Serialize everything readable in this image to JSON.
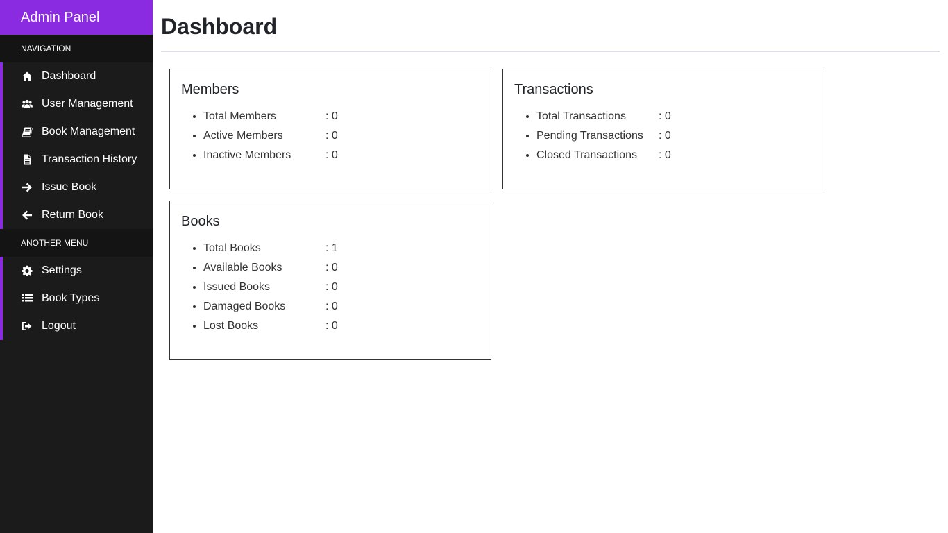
{
  "sidebar": {
    "brand": "Admin Panel",
    "sections": [
      {
        "header": "NAVIGATION",
        "items": [
          {
            "label": "Dashboard",
            "icon": "home-icon"
          },
          {
            "label": "User Management",
            "icon": "users-icon"
          },
          {
            "label": "Book Management",
            "icon": "book-icon"
          },
          {
            "label": "Transaction History",
            "icon": "file-icon"
          },
          {
            "label": "Issue Book",
            "icon": "arrow-right-icon"
          },
          {
            "label": "Return Book",
            "icon": "arrow-left-icon"
          }
        ]
      },
      {
        "header": "ANOTHER MENU",
        "items": [
          {
            "label": "Settings",
            "icon": "gear-icon"
          },
          {
            "label": "Book Types",
            "icon": "list-icon"
          },
          {
            "label": "Logout",
            "icon": "logout-icon"
          }
        ]
      }
    ]
  },
  "main": {
    "title": "Dashboard",
    "cards": {
      "members": {
        "title": "Members",
        "rows": [
          {
            "label": "Total Members",
            "value": ": 0"
          },
          {
            "label": "Active Members",
            "value": ": 0"
          },
          {
            "label": "Inactive Members",
            "value": ": 0"
          }
        ]
      },
      "transactions": {
        "title": "Transactions",
        "rows": [
          {
            "label": "Total Transactions",
            "value": ": 0"
          },
          {
            "label": "Pending Transactions",
            "value": ": 0"
          },
          {
            "label": "Closed Transactions",
            "value": ": 0"
          }
        ]
      },
      "books": {
        "title": "Books",
        "rows": [
          {
            "label": "Total Books",
            "value": ": 1"
          },
          {
            "label": "Available Books",
            "value": ": 0"
          },
          {
            "label": "Issued Books",
            "value": ": 0"
          },
          {
            "label": "Damaged Books",
            "value": ": 0"
          },
          {
            "label": "Lost Books",
            "value": ": 0"
          }
        ]
      }
    }
  },
  "colors": {
    "brand": "#8a2be2",
    "sidebar_bg": "#1b1b1b",
    "section_bg": "#141414"
  }
}
